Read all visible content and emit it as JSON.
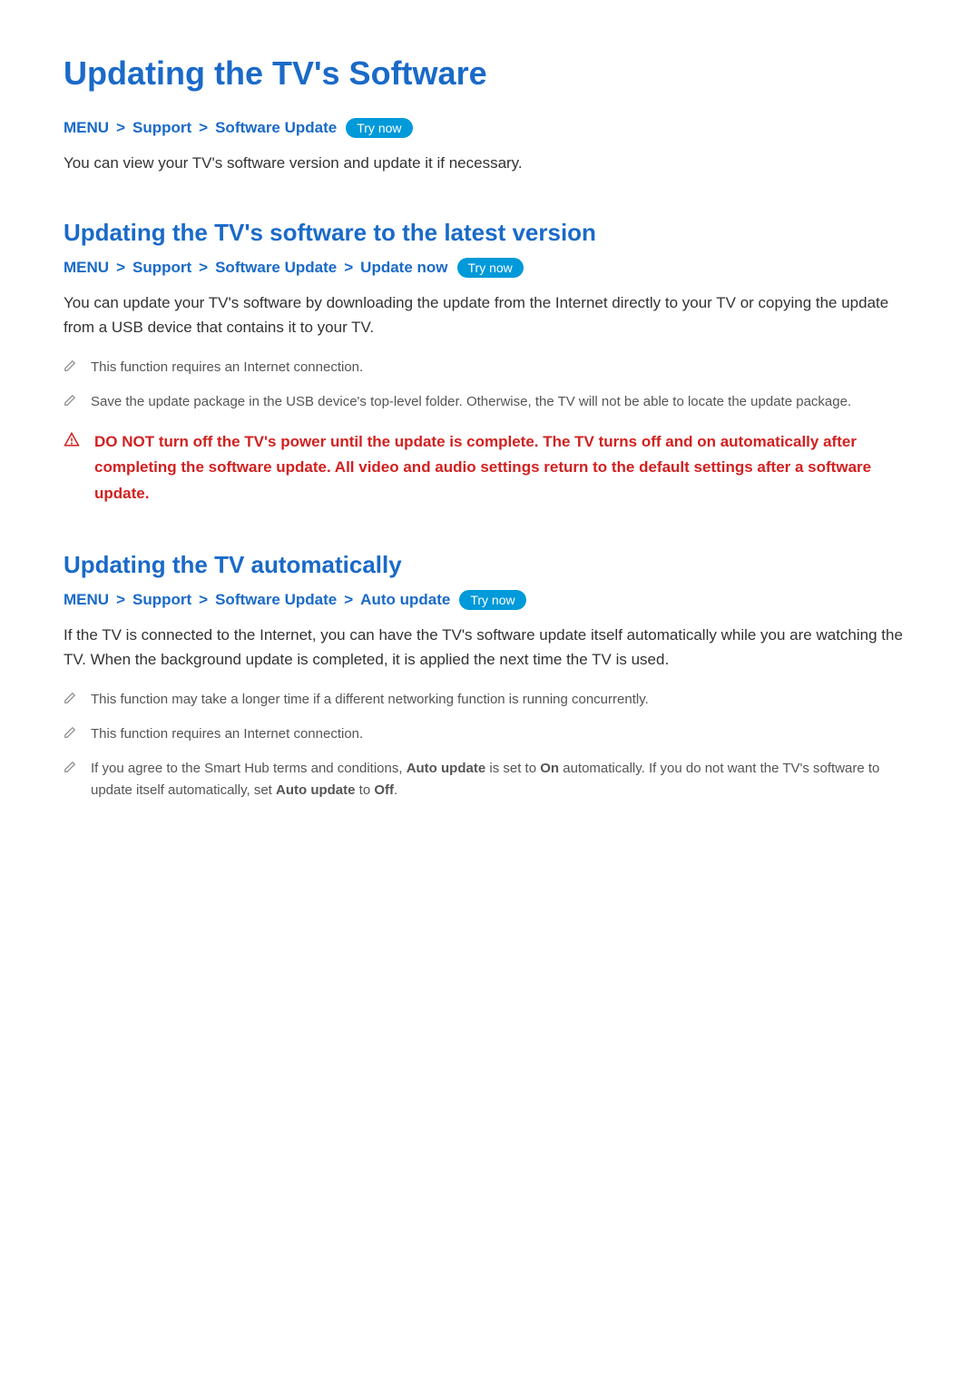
{
  "page_title": "Updating the TV's Software",
  "try_now_label": "Try now",
  "s1": {
    "crumbs": [
      "MENU",
      "Support",
      "Software Update"
    ],
    "body": "You can view your TV's software version and update it if necessary."
  },
  "s2": {
    "heading": "Updating the TV's software to the latest version",
    "crumbs": [
      "MENU",
      "Support",
      "Software Update",
      "Update now"
    ],
    "body": "You can update your TV's software by downloading the update from the Internet directly to your TV or copying the update from a USB device that contains it to your TV.",
    "notes": [
      "This function requires an Internet connection.",
      "Save the update package in the USB device's top-level folder. Otherwise, the TV will not be able to locate the update package."
    ],
    "warning": "DO NOT turn off the TV's power until the update is complete. The TV turns off and on automatically after completing the software update. All video and audio settings return to the default settings after a software update."
  },
  "s3": {
    "heading": "Updating the TV automatically",
    "crumbs": [
      "MENU",
      "Support",
      "Software Update",
      "Auto update"
    ],
    "body": "If the TV is connected to the Internet, you can have the TV's software update itself automatically while you are watching the TV. When the background update is completed, it is applied the next time the TV is used.",
    "notes": [
      "This function may take a longer time if a different networking function is running concurrently.",
      "This function requires an Internet connection."
    ],
    "note3_part1": "If you agree to the Smart Hub terms and conditions, ",
    "note3_bold1": "Auto update",
    "note3_part2": " is set to ",
    "note3_bold2": "On",
    "note3_part3": " automatically. If you do not want the TV's software to update itself automatically, set ",
    "note3_bold3": "Auto update",
    "note3_part4": " to ",
    "note3_bold4": "Off",
    "note3_part5": "."
  }
}
